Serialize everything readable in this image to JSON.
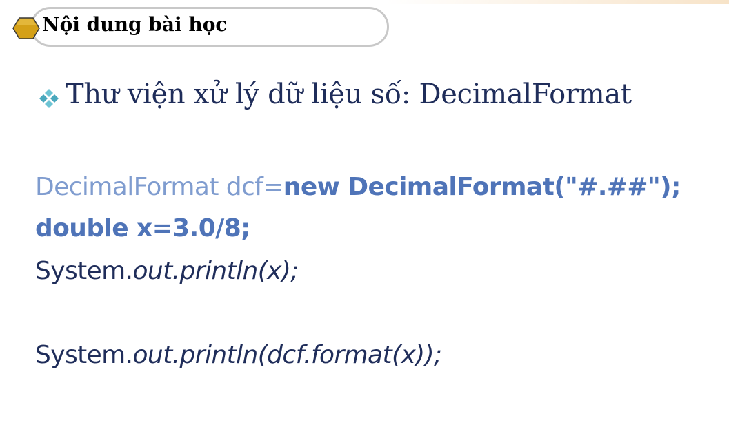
{
  "header": {
    "title": "Nội dung bài học"
  },
  "heading": {
    "text": "Thư viện xử lý dữ liệu số: DecimalFormat"
  },
  "code": {
    "line1_plain": "DecimalFormat dcf=",
    "line1_bold": "new DecimalFormat(\"#.##\");",
    "line2": "double x=3.0/8;",
    "line3_pre": "System.",
    "line3_italic": "out.println(x);",
    "line4_pre": "System.",
    "line4_italic": "out.println(dcf.format(x));"
  },
  "colors": {
    "heading": "#1f2d5a",
    "code_light": "#7f9ccf",
    "code_bold": "#4f74b8",
    "code_dark": "#1f2d5a",
    "hex_fill": "#d4a017",
    "bullet": "#5fb7c9"
  },
  "icons": {
    "header": "hexagon-icon",
    "bullet": "four-diamond-bullet-icon"
  }
}
